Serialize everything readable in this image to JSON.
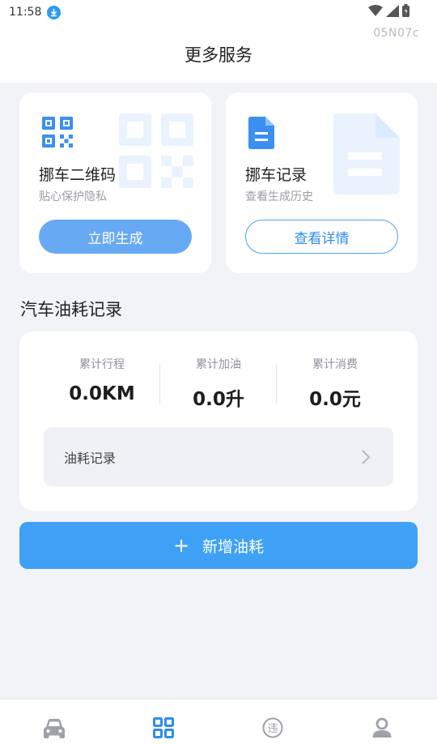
{
  "status_bar": {
    "time": "11:58",
    "build_tag": "05N07c"
  },
  "header": {
    "title": "更多服务"
  },
  "cards": {
    "qr": {
      "title": "挪车二维码",
      "subtitle": "贴心保护隐私",
      "button": "立即生成"
    },
    "records": {
      "title": "挪车记录",
      "subtitle": "查看生成历史",
      "button": "查看详情"
    }
  },
  "fuel": {
    "section_title": "汽车油耗记录",
    "stats": [
      {
        "label": "累计行程",
        "value": "0.0KM"
      },
      {
        "label": "累计加油",
        "value": "0.0升"
      },
      {
        "label": "累计消费",
        "value": "0.0元"
      }
    ],
    "record_row_label": "油耗记录",
    "add_button_icon": "+",
    "add_button": "新增油耗"
  },
  "tabbar": {
    "items": [
      "car-icon",
      "grid-icon",
      "violation-icon",
      "profile-icon"
    ],
    "active": "grid-icon",
    "violation_glyph": "违"
  },
  "colors": {
    "accent": "#3ea1f6",
    "light_blue_button": "#68a9f4",
    "active_tab": "#2d8fe8",
    "inactive_tab": "#9ea2a8"
  }
}
